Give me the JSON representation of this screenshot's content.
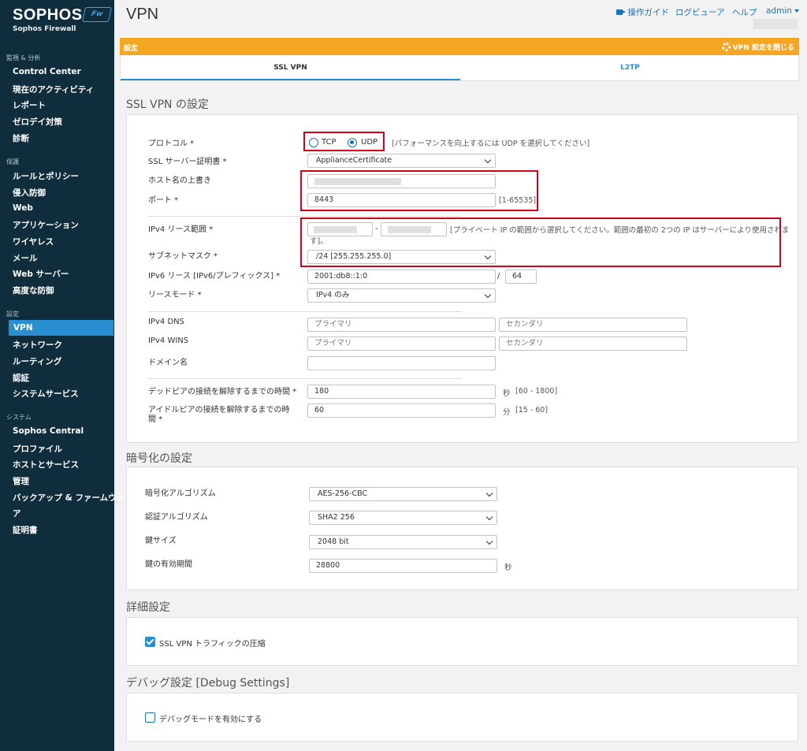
{
  "sidebar": {
    "logo": "SOPHOS",
    "logo_badge": "Fw",
    "logo_sub": "Sophos Firewall",
    "sections": [
      {
        "title": "監視 & 分析",
        "items": [
          "Control Center",
          "現在のアクティビティ",
          "レポート",
          "ゼロデイ対策",
          "診断"
        ]
      },
      {
        "title": "保護",
        "items": [
          "ルールとポリシー",
          "侵入防御",
          "Web",
          "アプリケーション",
          "ワイヤレス",
          "メール",
          "Web サーバー",
          "高度な防御"
        ]
      },
      {
        "title": "設定",
        "items": [
          "VPN",
          "ネットワーク",
          "ルーティング",
          "認証",
          "システムサービス"
        ]
      },
      {
        "title": "システム",
        "items": [
          "Sophos Central",
          "プロファイル",
          "ホストとサービス",
          "管理",
          "バックアップ & ファームウェ",
          "ア",
          "証明書"
        ]
      }
    ],
    "active_item": "VPN"
  },
  "header": {
    "title": "VPN",
    "guide": "操作ガイド",
    "log_viewer": "ログビューア",
    "help": "ヘルプ",
    "user": "admin"
  },
  "bar": {
    "left": "設定",
    "right": "VPN 設定を閉じる"
  },
  "tabs": [
    "SSL VPN",
    "L2TP"
  ],
  "ssl": {
    "title": "SSL VPN の設定",
    "protocol_label": "プロトコル *",
    "tcp": "TCP",
    "udp": "UDP",
    "selected_protocol": "UDP",
    "protocol_hint": "[パフォーマンスを向上するには UDP を選択してください]",
    "cert_label": "SSL サーバー証明書 *",
    "cert_value": "ApplianceCertificate",
    "host_label": "ホスト名の上書き",
    "port_label": "ポート *",
    "port_value": "8443",
    "port_hint": "[1-65535]",
    "ipv4_range_label": "IPv4 リース範囲 *",
    "range_sep": "-",
    "ipv4_range_hint_1": "[プライベート IP の範囲から選択してください。範囲の最初の 2つの IP はサーバーにより使用されま",
    "ipv4_range_hint_2": "す]。",
    "subnet_label": "サブネットマスク *",
    "subnet_value": "/24 [255.255.255.0]",
    "ipv6_label": "IPv6 リース [IPv6/プレフィックス] *",
    "ipv6_value": "2001:db8::1:0",
    "ipv6_sep": "/",
    "ipv6_prefix": "64",
    "lease_mode_label": "リースモード *",
    "lease_mode_value": "IPv4 のみ",
    "dns_label": "IPv4 DNS",
    "wins_label": "IPv4 WINS",
    "primary_ph": "プライマリ",
    "secondary_ph": "セカンダリ",
    "domain_label": "ドメイン名",
    "dead_peer_label": "デッドピアの接続を解除するまでの時間 *",
    "dead_peer_value": "180",
    "dead_peer_unit": "秒",
    "dead_peer_hint": "[60 - 1800]",
    "idle_peer_label_1": "アイドルピアの接続を解除するまでの時",
    "idle_peer_label_2": "間 *",
    "idle_peer_value": "60",
    "idle_peer_unit": "分",
    "idle_peer_hint": "[15 - 60]"
  },
  "crypto": {
    "title": "暗号化の設定",
    "algo_label": "暗号化アルゴリズム",
    "algo_value": "AES-256-CBC",
    "auth_label": "認証アルゴリズム",
    "auth_value": "SHA2 256",
    "key_label": "鍵サイズ",
    "key_value": "2048 bit",
    "life_label": "鍵の有効期間",
    "life_value": "28800",
    "life_unit": "秒"
  },
  "advanced": {
    "title": "詳細設定",
    "compress_label": "SSL VPN トラフィックの圧縮",
    "compress_checked": true
  },
  "debug": {
    "title": "デバッグ設定 [Debug Settings]",
    "debug_label": "デバッグモードを有効にする",
    "debug_checked": false
  },
  "colors": {
    "sidebar": "#0f2d3d",
    "accent": "#2a8fd0",
    "orange": "#f5a623",
    "highlight": "#d0021b"
  }
}
